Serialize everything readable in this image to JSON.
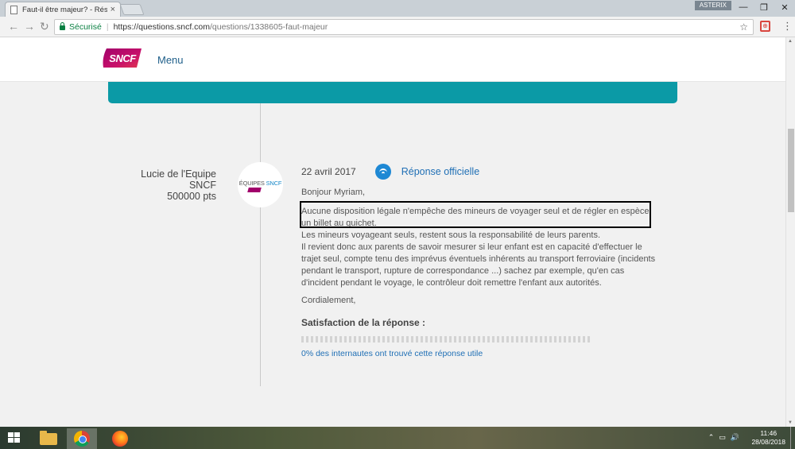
{
  "browser": {
    "tab_title": "Faut-il être majeur? - Rés",
    "tab_close": "×",
    "user_badge": "ASTERIX",
    "window_controls": {
      "minimize": "—",
      "restore": "❐",
      "close": "✕"
    },
    "nav": {
      "back": "←",
      "forward": "→",
      "reload": "↻"
    },
    "secure_label": "Sécurisé",
    "separator": "|",
    "url_host": "https://questions.sncf.com",
    "url_path": "/questions/1338605-faut-majeur",
    "star": "☆",
    "ext_label": "⊕",
    "menu": "⋮"
  },
  "site": {
    "logo_text": "SNCF",
    "menu_label": "Menu"
  },
  "answer": {
    "author_name_line1": "Lucie de l'Equipe",
    "author_name_line2": "SNCF",
    "author_points": "500000 pts",
    "avatar_label_prefix": "ÉQUIPES",
    "avatar_label_brand": "SNCF",
    "date": "22 avril 2017",
    "official_label": "Réponse officielle",
    "greeting": "Bonjour Myriam,",
    "paragraphs": [
      "Aucune disposition légale n'empêche des mineurs de voyager seul et de régler en espèce un billet au guichet.",
      "Les mineurs voyageant seuls, restent sous la responsabilité de leurs parents.",
      "Il revient donc aux parents de savoir mesurer si leur enfant est en capacité d'effectuer le trajet seul, compte tenu des imprévus éventuels inhérents au transport ferroviaire (incidents pendant le transport, rupture de correspondance ...) sachez par exemple, qu'en cas d'incident pendant le voyage, le contrôleur doit remettre l'enfant aux autorités."
    ],
    "sign_off": "Cordialement,",
    "satisfaction_label": "Satisfaction de la réponse :",
    "satisfaction_percent": 0,
    "useful_text": "0% des internautes ont trouvé cette réponse utile"
  },
  "taskbar": {
    "tray": [
      "⌃",
      "▭",
      "🔊"
    ],
    "time": "11:46",
    "date": "28/08/2018"
  },
  "colors": {
    "teal_bar": "#0b9aa6",
    "link_blue": "#1f6fb5",
    "sncf_magenta": "#a1006b"
  }
}
